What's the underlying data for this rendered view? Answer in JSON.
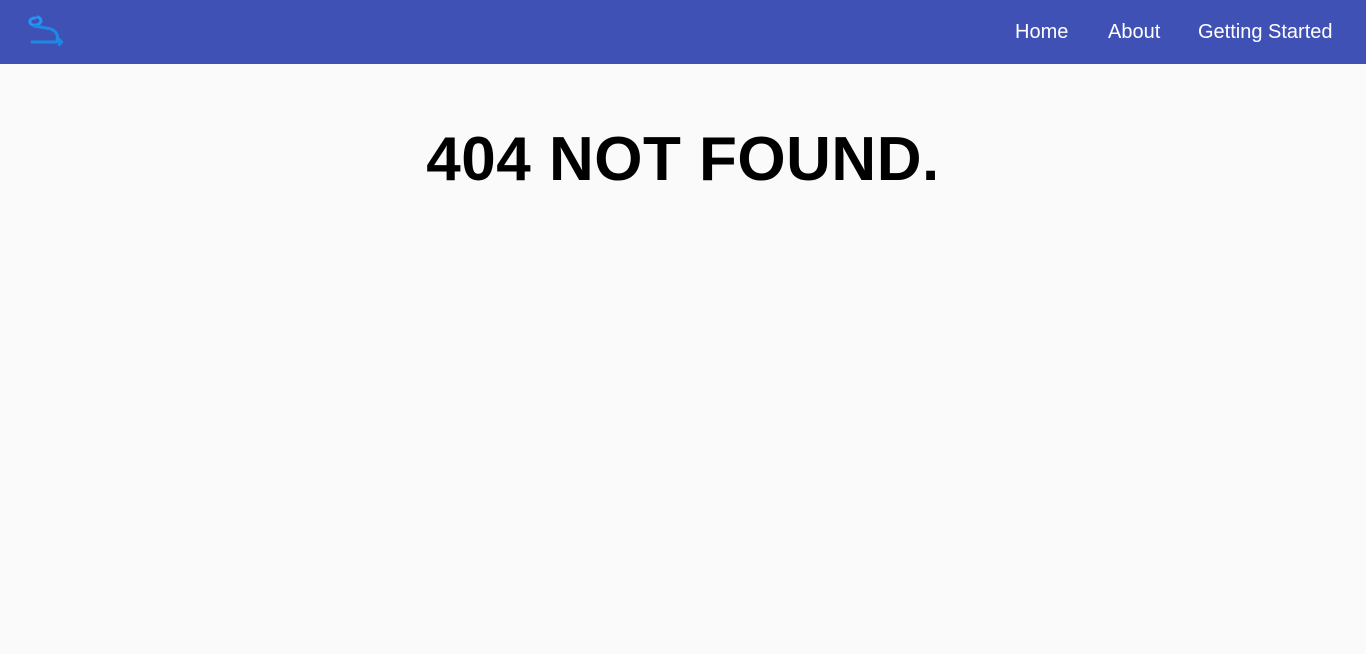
{
  "colors": {
    "header_background": "#3f51b5",
    "page_background": "#fafafa",
    "nav_text": "#ffffff",
    "title_text": "#000000",
    "logo_accent": "#2196f3"
  },
  "header": {
    "logo_icon": "logo-icon",
    "nav": {
      "home": "Home",
      "about": "About",
      "getting_started": "Getting Started"
    }
  },
  "main": {
    "title": "404 NOT FOUND."
  }
}
